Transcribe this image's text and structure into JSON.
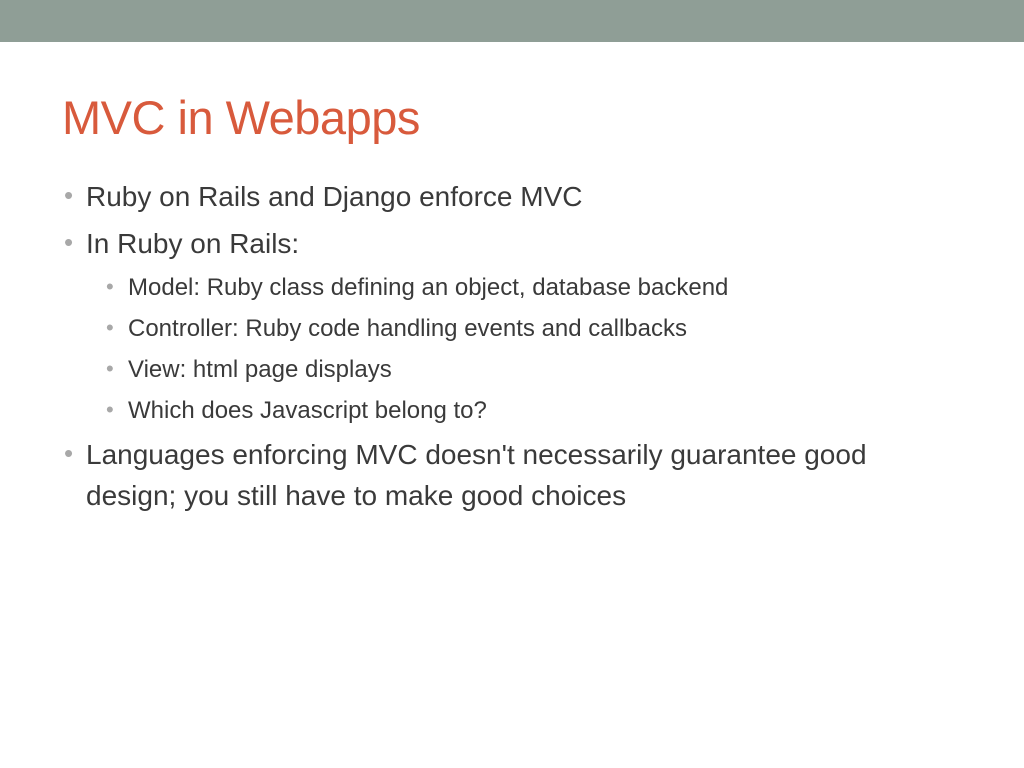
{
  "title": "MVC in Webapps",
  "bullets": {
    "l1_0": "Ruby on Rails and Django enforce MVC",
    "l1_1": "In Ruby on Rails:",
    "l1_2": "Languages enforcing MVC doesn't necessarily guarantee good design; you still have to make good choices",
    "l2_0": "Model: Ruby class defining an object, database backend",
    "l2_1": "Controller: Ruby code handling events and callbacks",
    "l2_2": "View: html page displays",
    "l2_3": "Which does Javascript belong to?"
  },
  "colors": {
    "top_bar": "#8f9e96",
    "title": "#d85a3c",
    "body_text": "#3a3a3a",
    "bullet": "#a8a8a8"
  }
}
